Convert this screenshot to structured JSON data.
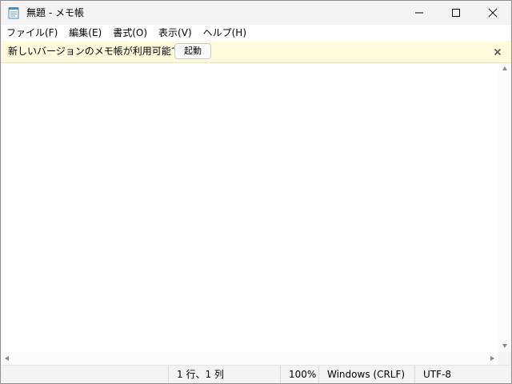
{
  "window": {
    "title": "無題 - メモ帳"
  },
  "menu": {
    "items": [
      "ファイル(F)",
      "編集(E)",
      "書式(O)",
      "表示(V)",
      "ヘルプ(H)"
    ]
  },
  "infobar": {
    "message": "新しいバージョンのメモ帳が利用可能です。",
    "launch_label": "起動"
  },
  "editor": {
    "content": ""
  },
  "status": {
    "position": "1 行、1 列",
    "zoom": "100%",
    "line_ending": "Windows (CRLF)",
    "encoding": "UTF-8"
  },
  "colors": {
    "infobar_bg": "#fdfbdc",
    "chrome_bg": "#f3f3f3"
  },
  "icons": [
    "notepad-icon",
    "minimize-icon",
    "maximize-icon",
    "close-icon",
    "dismiss-icon"
  ]
}
